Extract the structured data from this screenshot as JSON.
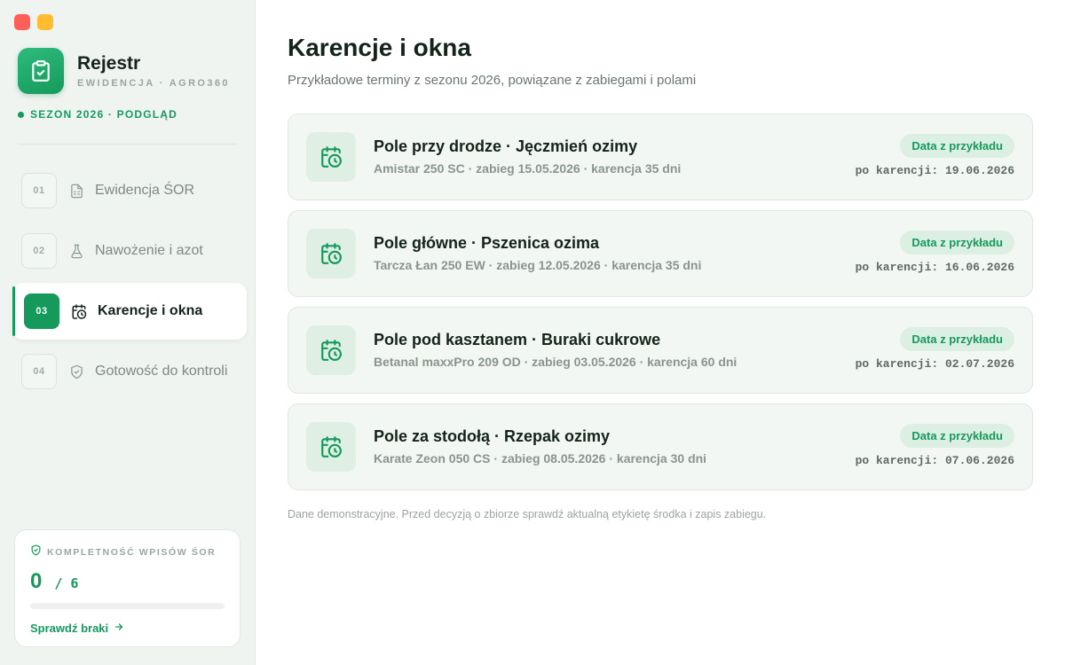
{
  "app": {
    "name": "Rejestr",
    "subtitle": "EWIDENCJA · AGRO360",
    "season": "SEZON 2026 · PODGLĄD"
  },
  "nav": {
    "items": [
      {
        "num": "01",
        "label": "Ewidencja ŚOR",
        "icon": "document-icon",
        "active": false
      },
      {
        "num": "02",
        "label": "Nawożenie i azot",
        "icon": "flask-icon",
        "active": false
      },
      {
        "num": "03",
        "label": "Karencje i okna",
        "icon": "calendar-clock-icon",
        "active": true
      },
      {
        "num": "04",
        "label": "Gotowość do kontroli",
        "icon": "shield-check-icon",
        "active": false
      }
    ]
  },
  "kpi": {
    "title": "KOMPLETNOŚĆ WPISÓW ŚOR",
    "count": "0",
    "separator": "/",
    "total": "6",
    "progress": 0,
    "link": "Sprawdź braki"
  },
  "main": {
    "title": "Karencje i okna",
    "subtitle": "Przykładowe terminy z sezonu 2026, powiązane z zabiegami i polami",
    "cards": [
      {
        "title": "Pole przy drodze · Jęczmień ozimy",
        "detail": "Amistar 250 SC · zabieg 15.05.2026 · karencja 35 dni",
        "badge": "Data z przykładu",
        "date": "po karencji: 19.06.2026"
      },
      {
        "title": "Pole główne · Pszenica ozima",
        "detail": "Tarcza Łan 250 EW · zabieg 12.05.2026 · karencja 35 dni",
        "badge": "Data z przykładu",
        "date": "po karencji: 16.06.2026"
      },
      {
        "title": "Pole pod kasztanem · Buraki cukrowe",
        "detail": "Betanal maxxPro 209 OD · zabieg 03.05.2026 · karencja 60 dni",
        "badge": "Data z przykładu",
        "date": "po karencji: 02.07.2026"
      },
      {
        "title": "Pole za stodołą · Rzepak ozimy",
        "detail": "Karate Zeon 050 CS · zabieg 08.05.2026 · karencja 30 dni",
        "badge": "Data z przykładu",
        "date": "po karencji: 07.06.2026"
      }
    ],
    "footnote": "Dane demonstracyjne. Przed decyzją o zbiorze sprawdź aktualną etykietę środka i zapis zabiegu."
  },
  "colors": {
    "accent": "#169a5c",
    "sidebar_bg": "#eff4f0",
    "card_bg": "#f2f7f3",
    "window_close": "#ff5f57",
    "window_minimize": "#febc2e"
  }
}
